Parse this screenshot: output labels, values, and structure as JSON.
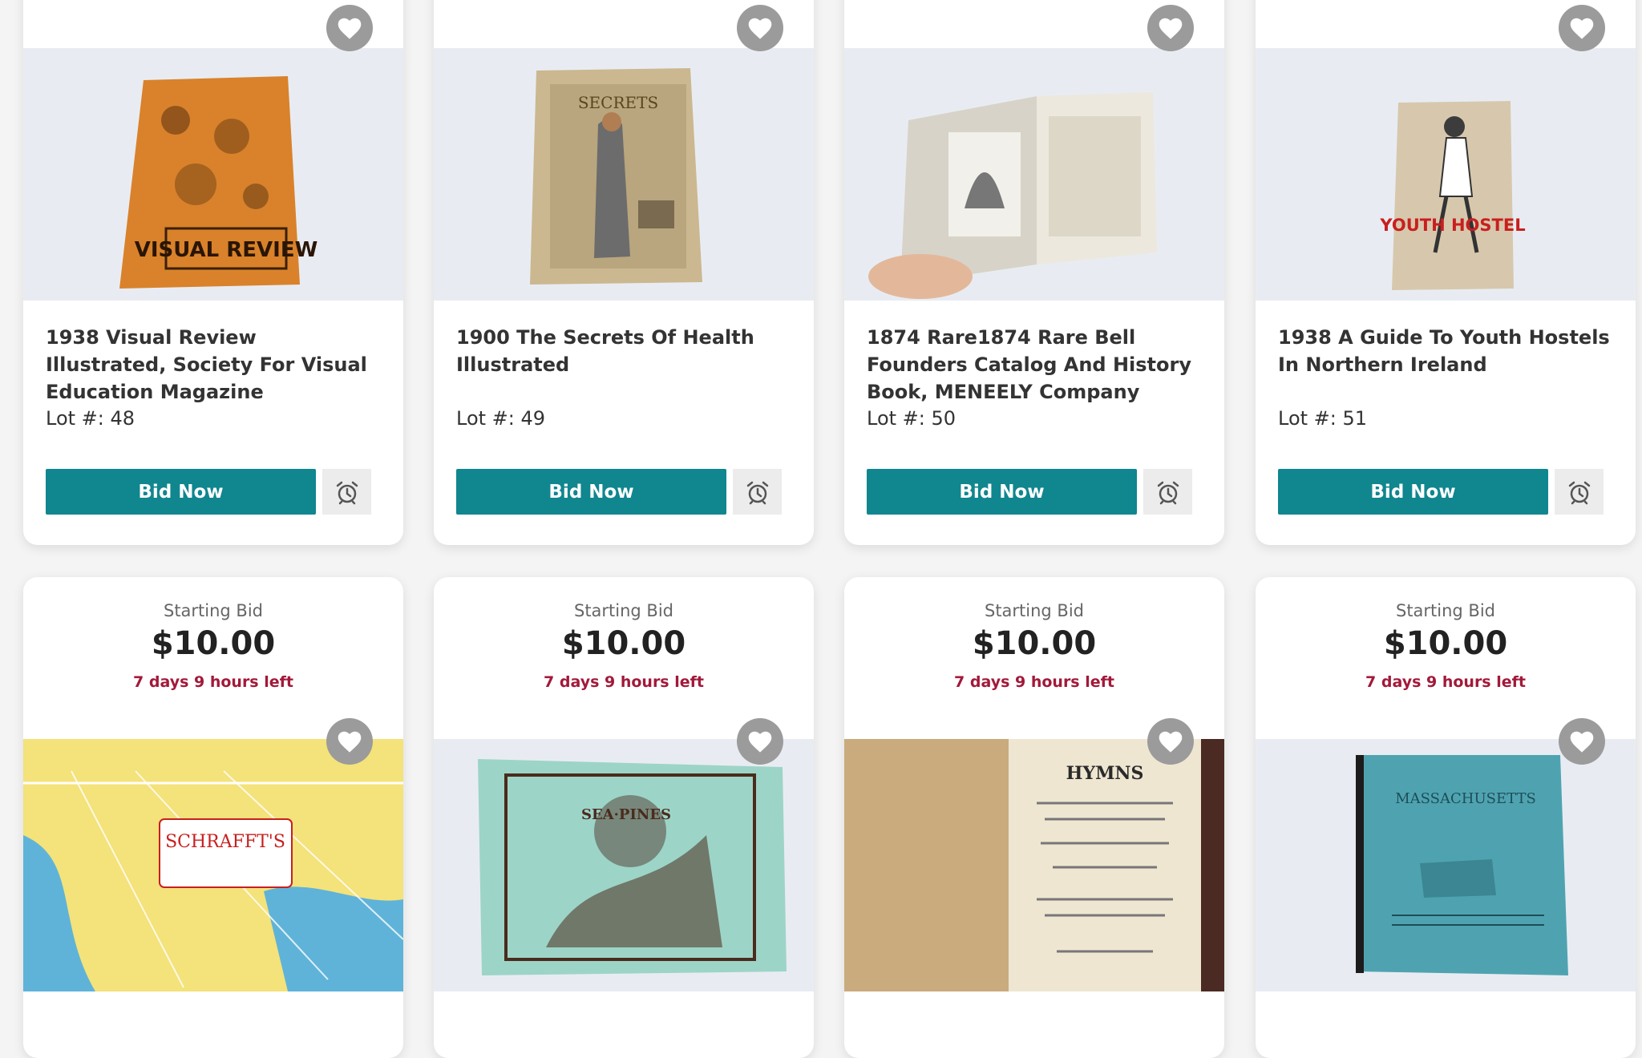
{
  "colors": {
    "accent": "#10868f",
    "time_left": "#a2193a",
    "favorite": "#9b9b9b"
  },
  "icons": {
    "favorite": "heart-icon",
    "watch": "alarm-clock-icon"
  },
  "top_row": [
    {
      "title": "1938 Visual Review Illustrated, Society For Visual Education Magazine",
      "lot": "Lot #: 48",
      "bid_label": "Bid Now",
      "image_text": "VISUAL REVIEW"
    },
    {
      "title": "1900 The Secrets Of Health Illustrated",
      "lot": "Lot #: 49",
      "bid_label": "Bid Now",
      "image_text": "SECRETS"
    },
    {
      "title": "1874 Rare1874 Rare Bell Founders Catalog And History Book, MENEELY Company",
      "lot": "Lot #: 50",
      "bid_label": "Bid Now",
      "image_text": ""
    },
    {
      "title": "1938 A Guide To Youth Hostels In Northern Ireland",
      "lot": "Lot #: 51",
      "bid_label": "Bid Now",
      "image_text": "YOUTH HOSTEL"
    }
  ],
  "bottom_row": [
    {
      "starting_label": "Starting Bid",
      "price": "$10.00",
      "time_left": "7 days 9 hours left",
      "image_text": "SCHRAFFT'S"
    },
    {
      "starting_label": "Starting Bid",
      "price": "$10.00",
      "time_left": "7 days 9 hours left",
      "image_text": "SEA·PINES"
    },
    {
      "starting_label": "Starting Bid",
      "price": "$10.00",
      "time_left": "7 days 9 hours left",
      "image_text": "HYMNS"
    },
    {
      "starting_label": "Starting Bid",
      "price": "$10.00",
      "time_left": "7 days 9 hours left",
      "image_text": "MASSACHUSETTS"
    }
  ]
}
